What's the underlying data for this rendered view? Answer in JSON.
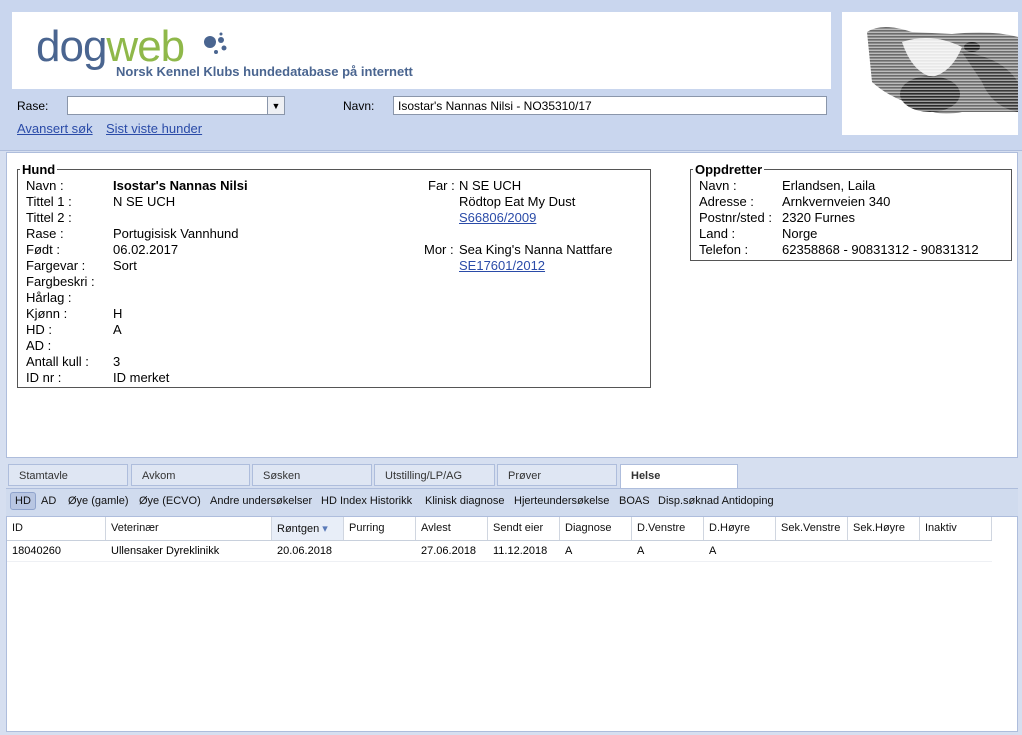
{
  "header": {
    "logo_part1": "dog",
    "logo_part2": "web",
    "tagline": "Norsk Kennel Klubs hundedatabase på internett",
    "rase_label": "Rase:",
    "rase_value": "",
    "navn_label": "Navn:",
    "navn_value": "Isostar's Nannas Nilsi - NO35310/17",
    "link_avansert": "Avansert søk",
    "link_sist": "Sist viste hunder"
  },
  "hund": {
    "legend": "Hund",
    "fields": [
      {
        "label": "Navn :",
        "value": "Isostar's Nannas Nilsi"
      },
      {
        "label": "Tittel 1 :",
        "value": "N SE UCH"
      },
      {
        "label": "Tittel 2 :",
        "value": ""
      },
      {
        "label": "Rase :",
        "value": "Portugisisk Vannhund"
      },
      {
        "label": "Født :",
        "value": "06.02.2017"
      },
      {
        "label": "Fargevar :",
        "value": "Sort"
      },
      {
        "label": "Fargbeskri :",
        "value": ""
      },
      {
        "label": "Hårlag :",
        "value": ""
      },
      {
        "label": "Kjønn :",
        "value": "H"
      },
      {
        "label": "HD :",
        "value": "A"
      },
      {
        "label": "AD :",
        "value": ""
      },
      {
        "label": "Antall kull :",
        "value": "3"
      },
      {
        "label": "ID nr :",
        "value": "ID merket"
      }
    ],
    "far_label": "Far :",
    "far_title": "N SE UCH",
    "far_name": "Rödtop Eat My Dust",
    "far_reg": "S66806/2009",
    "mor_label": "Mor :",
    "mor_name": "Sea King's Nanna Nattfare",
    "mor_reg": "SE17601/2012"
  },
  "oppdretter": {
    "legend": "Oppdretter",
    "fields": [
      {
        "label": "Navn :",
        "value": "Erlandsen, Laila"
      },
      {
        "label": "Adresse :",
        "value": "Arnkvernveien 340"
      },
      {
        "label": "Postnr/sted :",
        "value": "2320 Furnes"
      },
      {
        "label": "Land :",
        "value": "Norge"
      },
      {
        "label": "Telefon :",
        "value": "62358868 - 90831312 - 90831312"
      }
    ]
  },
  "tabs": [
    "Stamtavle",
    "Avkom",
    "Søsken",
    "Utstilling/LP/AG",
    "Prøver",
    "Helse"
  ],
  "active_tab": "Helse",
  "subtabs": [
    "HD",
    "AD",
    "Øye (gamle)",
    "Øye (ECVO)",
    "Andre undersøkelser",
    "HD Index Historikk",
    "Klinisk diagnose",
    "Hjerteundersøkelse",
    "BOAS",
    "Disp.søknad Antidoping"
  ],
  "active_subtab": "HD",
  "grid": {
    "columns": [
      "ID",
      "Veterinær",
      "Røntgen",
      "Purring",
      "Avlest",
      "Sendt eier",
      "Diagnose",
      "D.Venstre",
      "D.Høyre",
      "Sek.Venstre",
      "Sek.Høyre",
      "Inaktiv"
    ],
    "sorted_column": "Røntgen",
    "rows": [
      [
        "18040260",
        "Ullensaker Dyreklinikk",
        "20.06.2018",
        "",
        "27.06.2018",
        "11.12.2018",
        "A",
        "A",
        "A",
        "",
        "",
        ""
      ]
    ]
  },
  "colors": {
    "logo_blue": "#4a6590",
    "logo_green": "#8fb84a",
    "link": "#2a4ba8",
    "background": "#d6dff0"
  }
}
